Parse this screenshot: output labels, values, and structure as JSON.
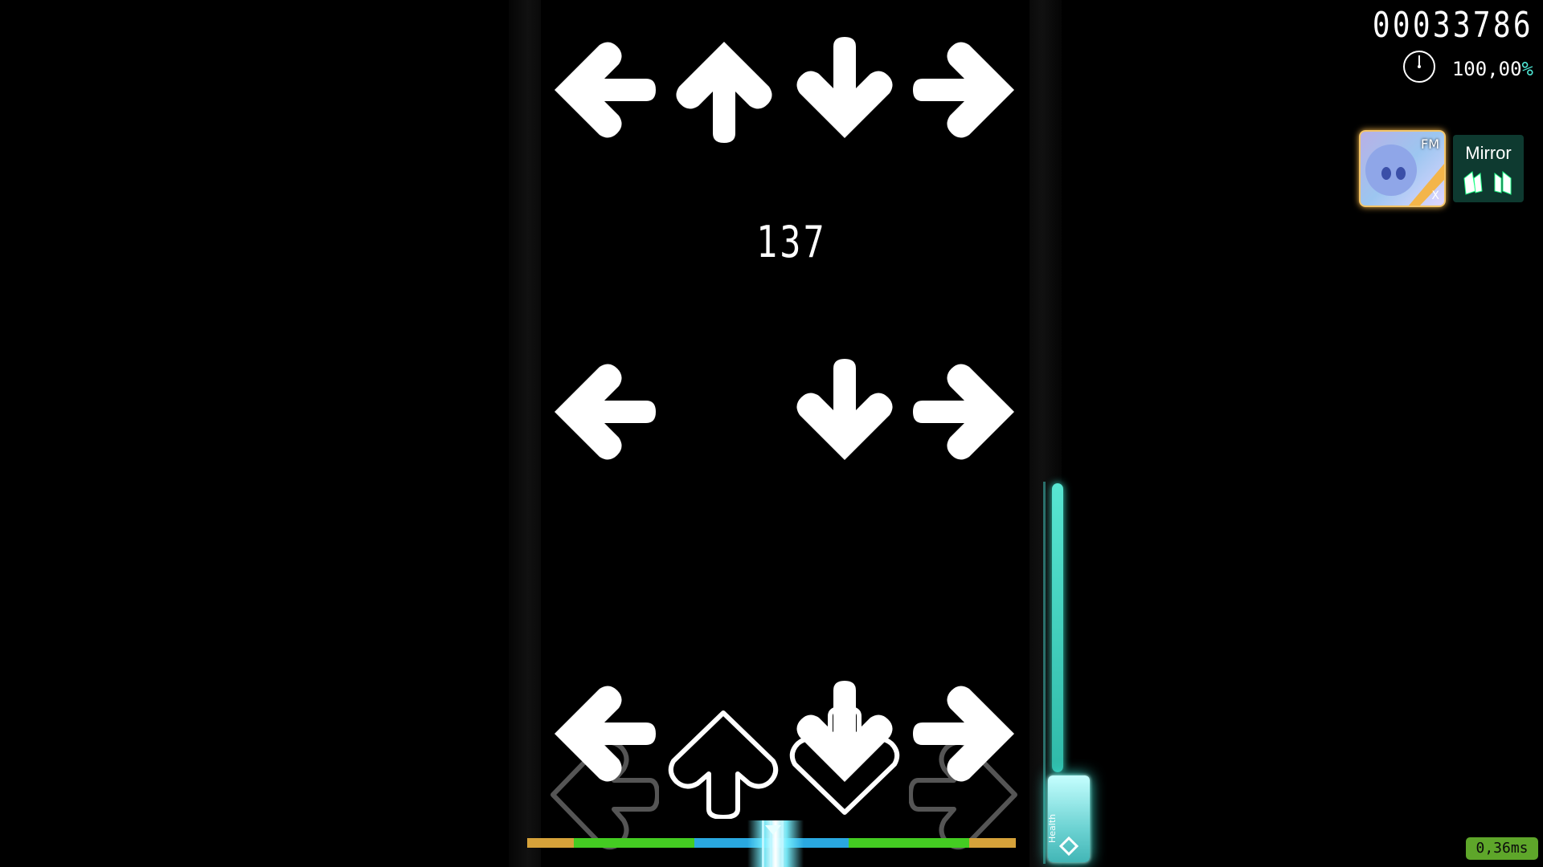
{
  "hud": {
    "score": "00033786",
    "accuracy_value": "100,00",
    "accuracy_suffix": "%",
    "latency": "0,36ms"
  },
  "combo": "137",
  "mods": [
    {
      "label": "FM",
      "extra": "X"
    },
    {
      "label": "Mirror"
    }
  ],
  "health": {
    "label": "Health",
    "level": 0.76
  },
  "icons": {
    "arrow-left": "left-arrow-icon",
    "arrow-up": "up-arrow-icon",
    "arrow-down": "down-arrow-icon",
    "arrow-right": "right-arrow-icon",
    "clock": "clock-icon"
  },
  "colors": {
    "accent": "#4fe8d6",
    "health": "#38d6c0",
    "latency_bg": "#5ea62a",
    "hit_bar": [
      "#d6a23a",
      "#44cc22",
      "#2aa8e0",
      "#44cc22",
      "#d6a23a"
    ]
  },
  "lanes": [
    "left",
    "up",
    "down",
    "right"
  ],
  "note_rows": [
    [
      "left",
      "up",
      "down",
      "right"
    ],
    [
      "left",
      null,
      "down",
      "right"
    ],
    [
      "left",
      null,
      "down",
      "right"
    ]
  ]
}
